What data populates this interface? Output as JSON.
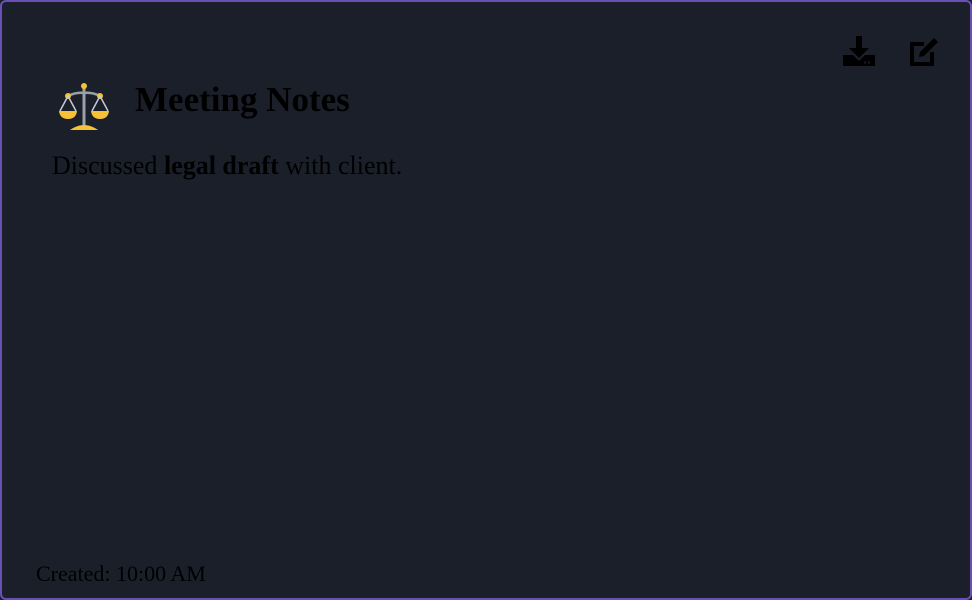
{
  "note": {
    "emoji": "⚖️",
    "title": "Meeting Notes",
    "body": {
      "before": "Discussed ",
      "bold": "legal draft",
      "after": " with client."
    },
    "created": "Created: 10:00 AM"
  },
  "actions": {
    "download_icon": "download-icon",
    "edit_icon": "edit-icon"
  },
  "colors": {
    "background": "#1b1f2a",
    "border": "#6a4fb8",
    "emoji_gold": "#f6c137"
  }
}
